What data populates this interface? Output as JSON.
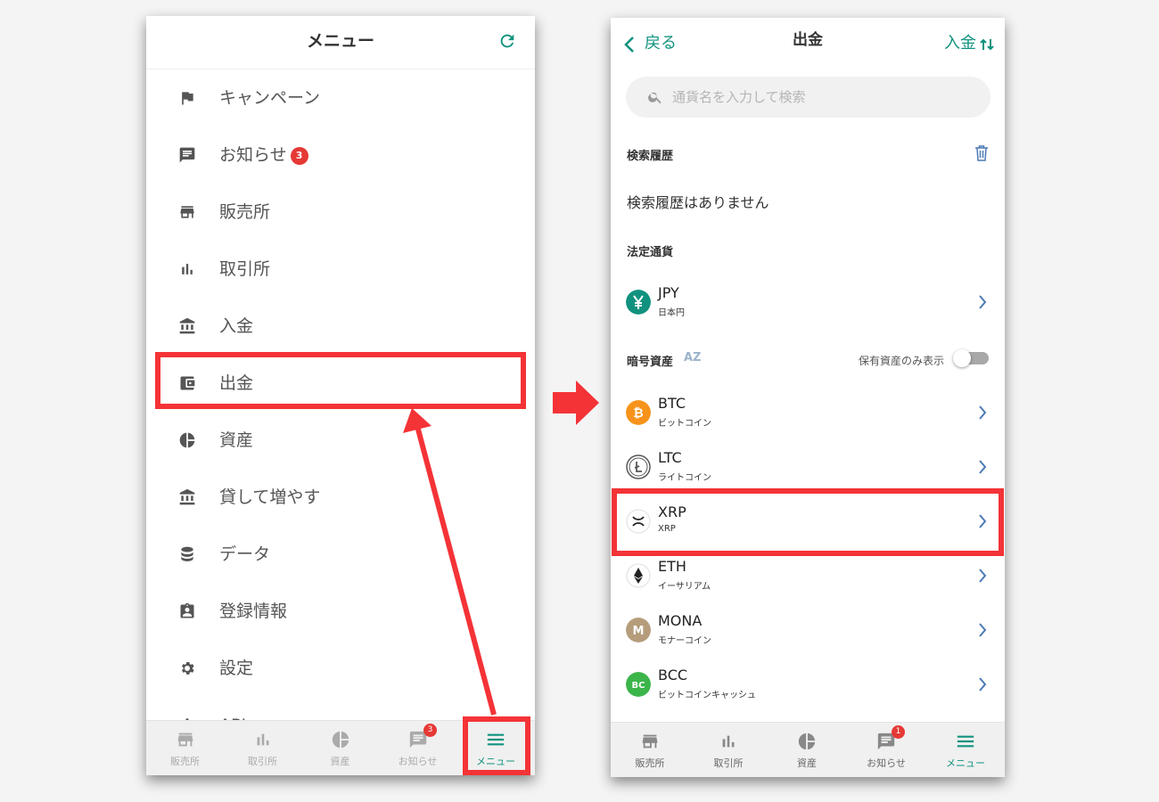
{
  "left_screen": {
    "title": "メニュー",
    "menu_items": [
      {
        "label": "キャンペーン",
        "icon": "flag-icon"
      },
      {
        "label": "お知らせ",
        "icon": "message-icon",
        "badge": "3"
      },
      {
        "label": "販売所",
        "icon": "store-icon"
      },
      {
        "label": "取引所",
        "icon": "bar-chart-icon"
      },
      {
        "label": "入金",
        "icon": "bank-icon"
      },
      {
        "label": "出金",
        "icon": "wallet-icon"
      },
      {
        "label": "資産",
        "icon": "pie-chart-icon"
      },
      {
        "label": "貸して増やす",
        "icon": "bank-icon"
      },
      {
        "label": "データ",
        "icon": "database-icon"
      },
      {
        "label": "登録情報",
        "icon": "id-badge-icon"
      },
      {
        "label": "設定",
        "icon": "gear-icon"
      },
      {
        "label": "API",
        "icon": "upload-icon"
      }
    ],
    "bottom_nav": [
      {
        "label": "販売所",
        "icon": "store-icon"
      },
      {
        "label": "取引所",
        "icon": "bar-chart-icon"
      },
      {
        "label": "資産",
        "icon": "pie-chart-icon"
      },
      {
        "label": "お知らせ",
        "icon": "message-icon",
        "badge": "3"
      },
      {
        "label": "メニュー",
        "icon": "hamburger-icon",
        "active": true
      }
    ]
  },
  "right_screen": {
    "back_label": "戻る",
    "title": "出金",
    "deposit_label": "入金",
    "search_placeholder": "通貨名を入力して検索",
    "search_history_heading": "検索履歴",
    "search_history_empty": "検索履歴はありません",
    "fiat_heading": "法定通貨",
    "fiat": [
      {
        "symbol": "JPY",
        "name": "日本円",
        "icon_color": "#11927f"
      }
    ],
    "crypto_heading": "暗号資産",
    "sort_label": "AZ",
    "hold_only_label": "保有資産のみ表示",
    "hold_only_on": false,
    "crypto": [
      {
        "symbol": "BTC",
        "name": "ビットコイン",
        "icon_color": "#f7931a"
      },
      {
        "symbol": "LTC",
        "name": "ライトコイン",
        "icon_color": "#ffffff"
      },
      {
        "symbol": "XRP",
        "name": "XRP",
        "icon_color": "#ffffff"
      },
      {
        "symbol": "ETH",
        "name": "イーサリアム",
        "icon_color": "#ffffff"
      },
      {
        "symbol": "MONA",
        "name": "モナーコイン",
        "icon_color": "#b59d7c"
      },
      {
        "symbol": "BCC",
        "name": "ビットコインキャッシュ",
        "icon_color": "#3bb54a"
      }
    ],
    "bottom_nav": [
      {
        "label": "販売所",
        "icon": "store-icon"
      },
      {
        "label": "取引所",
        "icon": "bar-chart-icon"
      },
      {
        "label": "資産",
        "icon": "pie-chart-icon"
      },
      {
        "label": "お知らせ",
        "icon": "message-icon",
        "badge": "1"
      },
      {
        "label": "メニュー",
        "icon": "hamburger-icon",
        "active": true
      }
    ]
  },
  "colors": {
    "accent": "#11927f",
    "highlight": "#f43337",
    "badge": "#e53935"
  }
}
